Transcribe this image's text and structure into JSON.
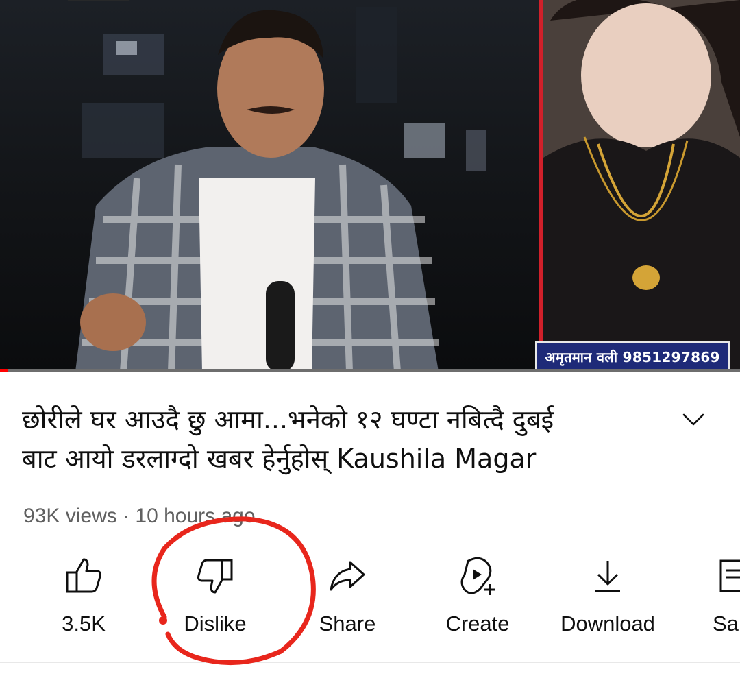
{
  "video": {
    "caption": "अमृतमान वली 9851297869",
    "progress_fraction": 0.01
  },
  "title": {
    "line1": "छोरीले घर आउदै छु आमा...भनेको १२ घण्टा नबित्दै दुबई",
    "line2": "बाट आयो डरलाग्दो खबर हेर्नुहोस् Kaushila Magar"
  },
  "meta": "93K views · 10 hours ago",
  "actions": [
    {
      "label": "3.5K",
      "icon": "thumbs-up-icon"
    },
    {
      "label": "Dislike",
      "icon": "thumbs-down-icon"
    },
    {
      "label": "Share",
      "icon": "share-icon"
    },
    {
      "label": "Create",
      "icon": "create-icon"
    },
    {
      "label": "Download",
      "icon": "download-icon"
    },
    {
      "label": "Sa",
      "icon": "save-icon"
    }
  ],
  "colors": {
    "annotation": "#e8261c",
    "progress": "#ff0000",
    "caption_banner": "#1e2a78",
    "meta_text": "#606060"
  }
}
